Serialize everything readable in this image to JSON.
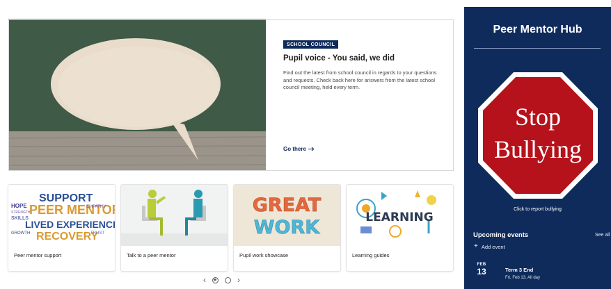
{
  "hero": {
    "tag": "SCHOOL COUNCIL",
    "title": "Pupil voice - You said, we did",
    "description": "Find out the latest from school council in regards to your questions and requests. Check back here for answers from the latest school council meeting, held every term.",
    "link_label": "Go there",
    "link_icon": "arrow-right-icon"
  },
  "cards": [
    {
      "label": "Peer mentor support",
      "art_words": [
        "SUPPORT",
        "HOPE",
        "PEER MENTOR",
        "SKILLS",
        "LIVED EXPERIENCE",
        "RECOVERY",
        "STRENGTH",
        "EMPATHY",
        "GROWTH",
        "TRUST"
      ]
    },
    {
      "label": "Talk to a peer mentor"
    },
    {
      "label": "Pupil work showcase",
      "art_words": [
        "GREAT",
        "WORK"
      ]
    },
    {
      "label": "Learning guides",
      "art_words": [
        "LEARNING"
      ]
    }
  ],
  "carousel": {
    "prev_icon": "chevron-left-icon",
    "next_icon": "chevron-right-icon",
    "pages": 2,
    "current": 1
  },
  "panel": {
    "title": "Peer Mentor Hub",
    "sign_words": [
      "Stop",
      "Bullying"
    ],
    "sign_caption": "Click to report bullying",
    "events_title": "Upcoming events",
    "see_all": "See all",
    "add_event": "Add event",
    "events": [
      {
        "month": "FEB",
        "day": "13",
        "title": "Term 3 End",
        "subtitle": "Fri, Feb 13, All day"
      }
    ]
  },
  "colors": {
    "brand_navy": "#0f2b5c",
    "sign_red": "#b5121b",
    "board_green": "#3b5543"
  }
}
